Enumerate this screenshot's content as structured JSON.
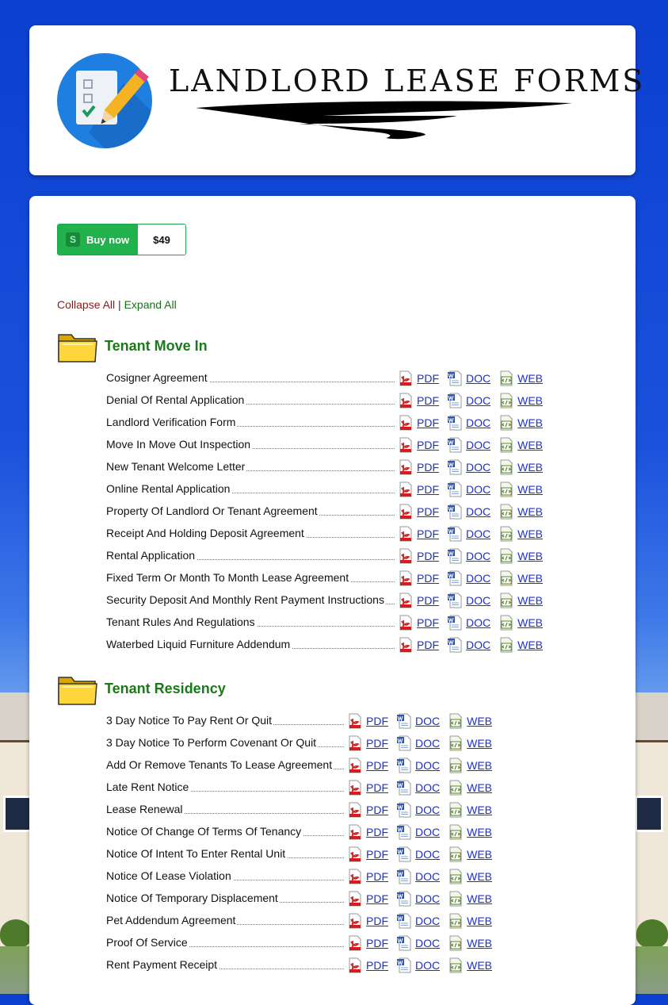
{
  "header": {
    "title": "LANDLORD LEASE FORMS"
  },
  "buy": {
    "label": "Buy now",
    "price": "$49",
    "logo_letter": "S"
  },
  "toggles": {
    "collapse": "Collapse All",
    "separator": "|",
    "expand": "Expand All"
  },
  "link_labels": {
    "pdf": "PDF",
    "doc": "DOC",
    "web": "WEB"
  },
  "sections": [
    {
      "title": "Tenant Move In",
      "forms": [
        "Cosigner Agreement",
        "Denial Of Rental Application",
        "Landlord Verification Form",
        "Move In Move Out Inspection",
        "New Tenant Welcome Letter",
        "Online Rental Application",
        "Property Of Landlord Or Tenant Agreement",
        "Receipt And Holding Deposit Agreement",
        "Rental Application",
        "Fixed Term Or Month To Month Lease Agreement",
        "Security Deposit And Monthly Rent Payment Instructions",
        "Tenant Rules And Regulations",
        "Waterbed Liquid Furniture Addendum"
      ]
    },
    {
      "title": "Tenant Residency",
      "forms": [
        "3 Day Notice To Pay Rent Or Quit",
        "3 Day Notice To Perform Covenant Or Quit",
        "Add Or Remove Tenants To Lease Agreement",
        "Late Rent Notice",
        "Lease Renewal",
        "Notice Of Change Of Terms Of Tenancy",
        "Notice Of Intent To Enter Rental Unit",
        "Notice Of Lease Violation",
        "Notice Of Temporary Displacement",
        "Pet Addendum Agreement",
        "Proof Of Service",
        "Rent Payment Receipt"
      ]
    }
  ]
}
